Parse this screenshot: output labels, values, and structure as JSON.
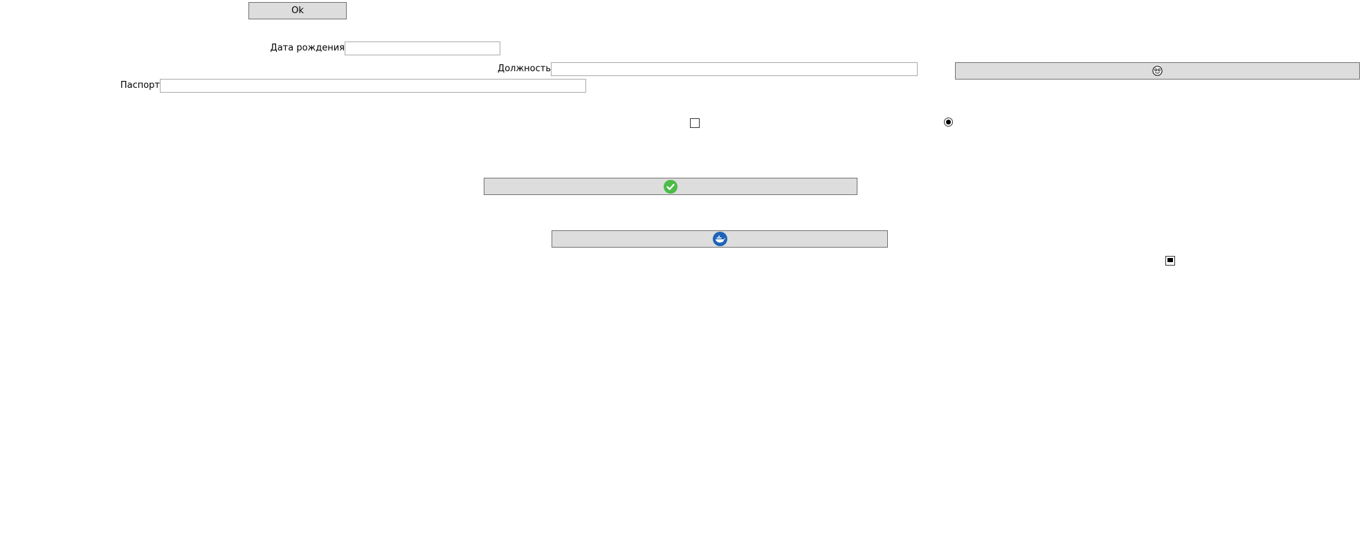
{
  "ok_button": {
    "label": "Ok"
  },
  "form": {
    "birth_date": {
      "label": "Дата рождения",
      "value": ""
    },
    "position": {
      "label": "Должность",
      "value": ""
    },
    "passport": {
      "label": "Паспорт",
      "value": ""
    }
  },
  "controls": {
    "checkbox_checked": false,
    "radio_selected": true,
    "checkbox_indeterminate": true
  },
  "icons": {
    "emoji_button": "face-icon",
    "check_button": "green-check-icon",
    "whale_button": "docker-whale-icon"
  },
  "colors": {
    "button_bg": "#dddddd",
    "check_green": "#4cbb48",
    "docker_blue": "#1d63b8"
  }
}
